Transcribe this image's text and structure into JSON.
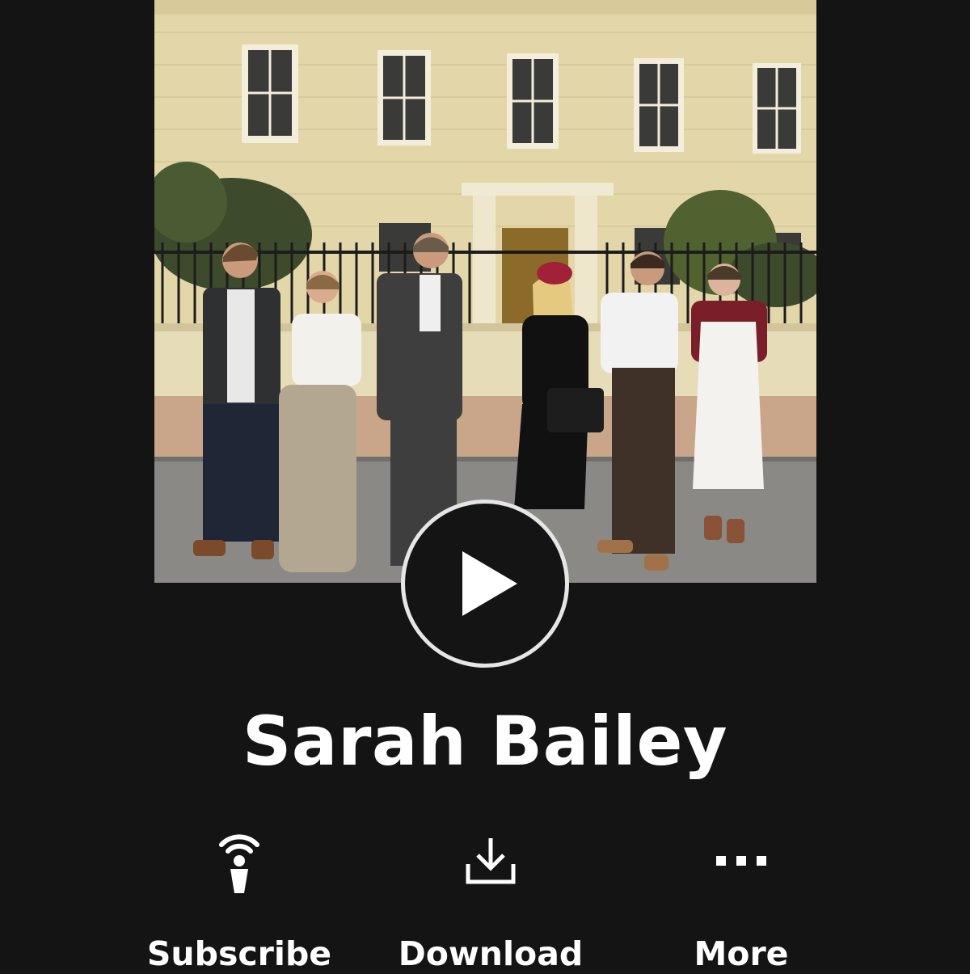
{
  "episode": {
    "title": "Sarah Bailey"
  },
  "artwork": {
    "subject": "cast-photo",
    "palette": {
      "facade": "#e3d6a8",
      "sky": "#d9d0ad",
      "road": "#8a8986",
      "railing": "#1c1c1c",
      "foliage": "#3d4a2c"
    }
  },
  "player": {
    "play_icon": "play-icon"
  },
  "actions": {
    "subscribe": {
      "label": "Subscribe",
      "icon": "subscribe-icon"
    },
    "download": {
      "label": "Download",
      "icon": "download-icon"
    },
    "more": {
      "label": "More",
      "icon": "more-dots-icon"
    }
  },
  "theme": {
    "background": "#141414",
    "text": "#ffffff",
    "play_ring": "#e6e6e6"
  }
}
